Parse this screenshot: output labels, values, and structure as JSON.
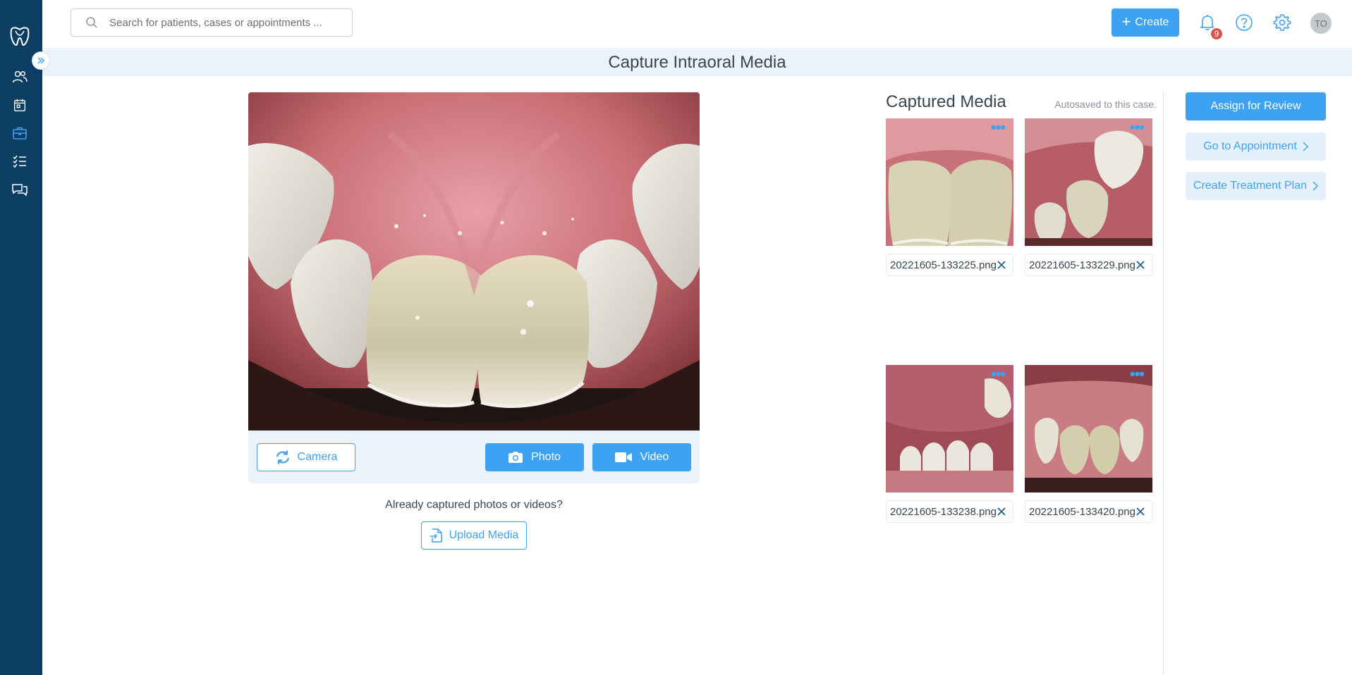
{
  "header": {
    "search_placeholder": "Search for patients, cases or appointments ...",
    "create_label": "Create",
    "notification_count": "9",
    "avatar_initials": "TO"
  },
  "sidebar": {
    "items": [
      {
        "icon": "patients-icon"
      },
      {
        "icon": "calendar-icon"
      },
      {
        "icon": "cases-icon",
        "active": true
      },
      {
        "icon": "tasks-icon"
      },
      {
        "icon": "messages-icon"
      }
    ]
  },
  "page": {
    "title": "Capture Intraoral Media"
  },
  "capture": {
    "camera_label": "Camera",
    "photo_label": "Photo",
    "video_label": "Video",
    "already_text": "Already captured photos or videos?",
    "upload_label": "Upload Media"
  },
  "media": {
    "title": "Captured Media",
    "autosave_text": "Autosaved to this case.",
    "items": [
      {
        "filename": "20221605-133225.png"
      },
      {
        "filename": "20221605-133229.png"
      },
      {
        "filename": "20221605-133238.png"
      },
      {
        "filename": "20221605-133420.png"
      }
    ]
  },
  "actions": {
    "assign_label": "Assign for Review",
    "appointment_label": "Go to Appointment",
    "treatment_label": "Create Treatment Plan"
  },
  "colors": {
    "sidebar": "#0c3d63",
    "accent": "#3ea2f2",
    "band": "#eaf3fc",
    "badge": "#d9534f"
  }
}
